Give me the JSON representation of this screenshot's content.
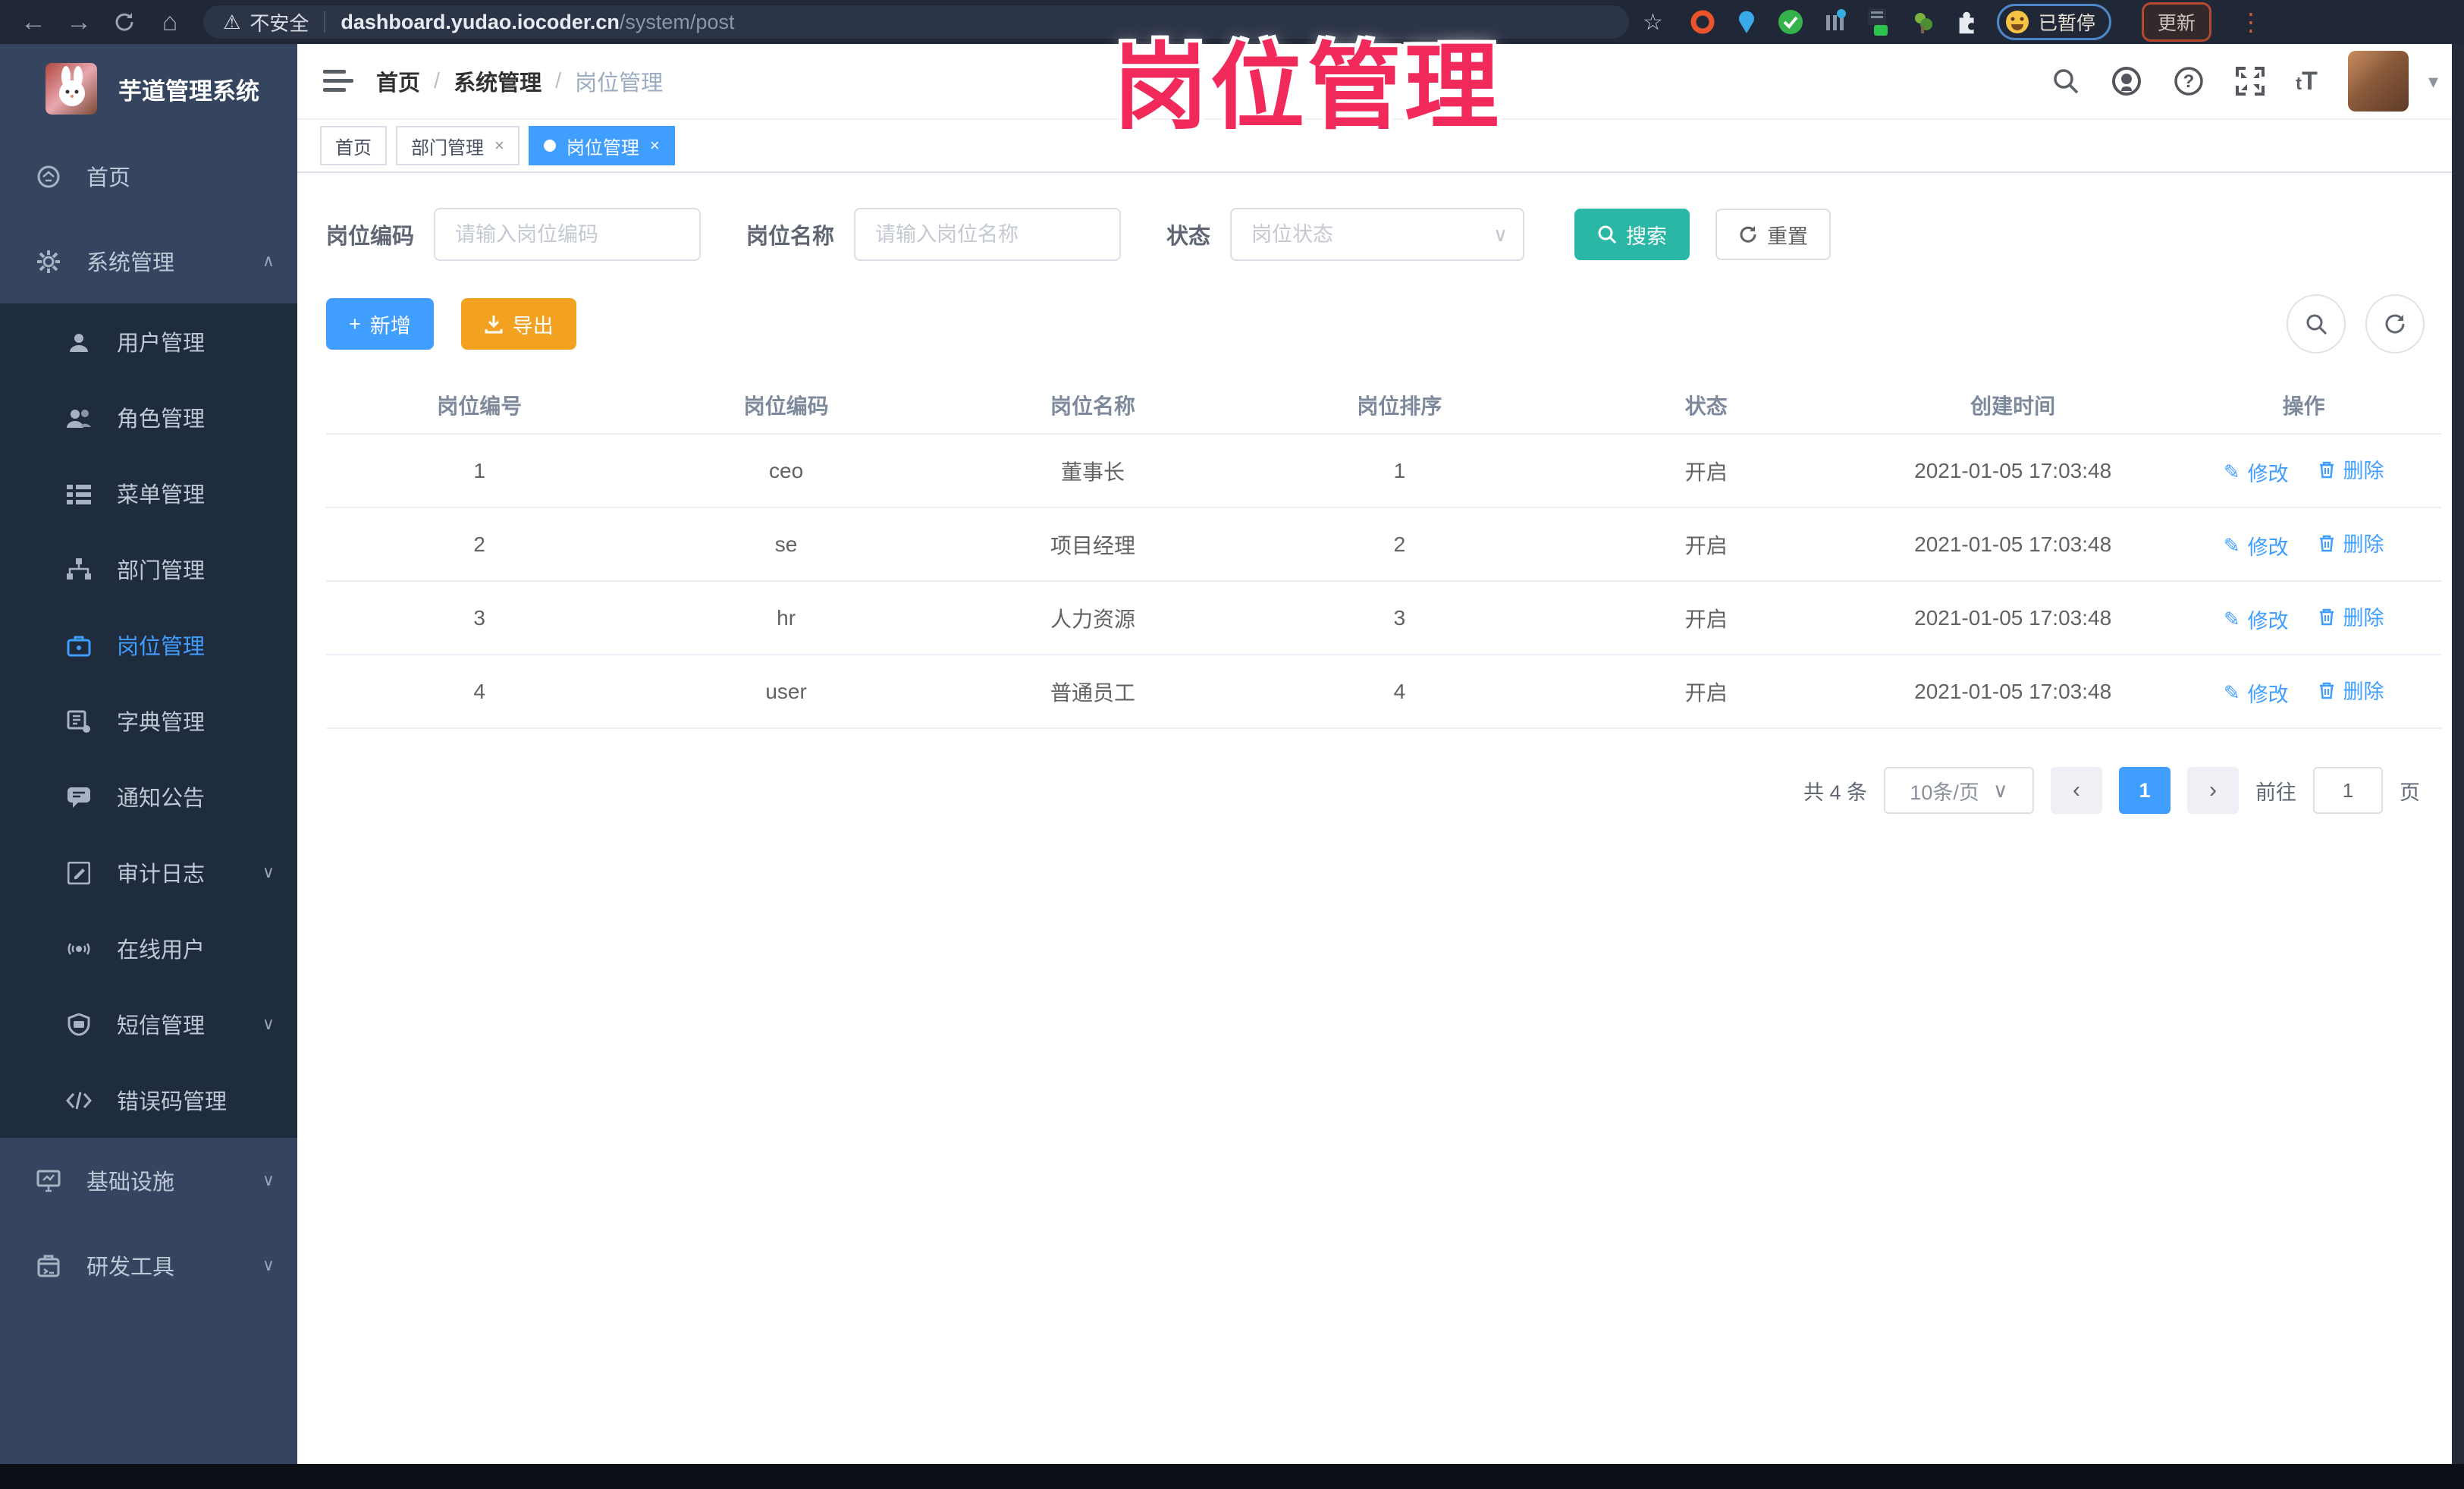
{
  "browser": {
    "security_label": "不安全",
    "url_domain": "dashboard.yudao.iocoder.cn",
    "url_path": "/system/post",
    "paused_badge": "已暂停",
    "update_button": "更新"
  },
  "overlay_title": "岗位管理",
  "icons": {
    "back": "←",
    "forward": "→",
    "home": "⌂",
    "warning": "⚠",
    "star": "☆",
    "menu_dots": "⋮",
    "caret_down": "▾",
    "chevron_up": "∧",
    "chevron_down": "∨",
    "plus": "+",
    "pencil": "✎",
    "prev": "‹",
    "next": "›",
    "close": "×"
  },
  "sidebar": {
    "app_title": "芋道管理系统",
    "items": [
      {
        "label": "首页"
      },
      {
        "label": "系统管理"
      },
      {
        "label": "用户管理"
      },
      {
        "label": "角色管理"
      },
      {
        "label": "菜单管理"
      },
      {
        "label": "部门管理"
      },
      {
        "label": "岗位管理"
      },
      {
        "label": "字典管理"
      },
      {
        "label": "通知公告"
      },
      {
        "label": "审计日志"
      },
      {
        "label": "在线用户"
      },
      {
        "label": "短信管理"
      },
      {
        "label": "错误码管理"
      },
      {
        "label": "基础设施"
      },
      {
        "label": "研发工具"
      }
    ]
  },
  "breadcrumb": [
    "首页",
    "系统管理",
    "岗位管理"
  ],
  "tabs": [
    {
      "label": "首页"
    },
    {
      "label": "部门管理"
    },
    {
      "label": "岗位管理"
    }
  ],
  "filters": {
    "post_code_label": "岗位编码",
    "post_code_placeholder": "请输入岗位编码",
    "post_name_label": "岗位名称",
    "post_name_placeholder": "请输入岗位名称",
    "status_label": "状态",
    "status_placeholder": "岗位状态",
    "search_label": "搜索",
    "reset_label": "重置"
  },
  "toolbar": {
    "add_label": "新增",
    "export_label": "导出"
  },
  "table": {
    "columns": [
      "岗位编号",
      "岗位编码",
      "岗位名称",
      "岗位排序",
      "状态",
      "创建时间",
      "操作"
    ],
    "edit_label": "修改",
    "delete_label": "删除",
    "rows": [
      {
        "id": "1",
        "code": "ceo",
        "name": "董事长",
        "sort": "1",
        "status": "开启",
        "created": "2021-01-05 17:03:48"
      },
      {
        "id": "2",
        "code": "se",
        "name": "项目经理",
        "sort": "2",
        "status": "开启",
        "created": "2021-01-05 17:03:48"
      },
      {
        "id": "3",
        "code": "hr",
        "name": "人力资源",
        "sort": "3",
        "status": "开启",
        "created": "2021-01-05 17:03:48"
      },
      {
        "id": "4",
        "code": "user",
        "name": "普通员工",
        "sort": "4",
        "status": "开启",
        "created": "2021-01-05 17:03:48"
      }
    ]
  },
  "pagination": {
    "total_text": "共 4 条",
    "page_size": "10条/页",
    "current_page": "1",
    "goto_label": "前往",
    "goto_value": "1",
    "page_suffix": "页"
  },
  "colors": {
    "primary": "#409eff",
    "search_teal": "#2bb7a6",
    "export_orange": "#f2a120",
    "annotation_pink": "#f22a5b",
    "sidebar_bg": "#35455f",
    "submenu_bg": "#1f2c3d"
  }
}
